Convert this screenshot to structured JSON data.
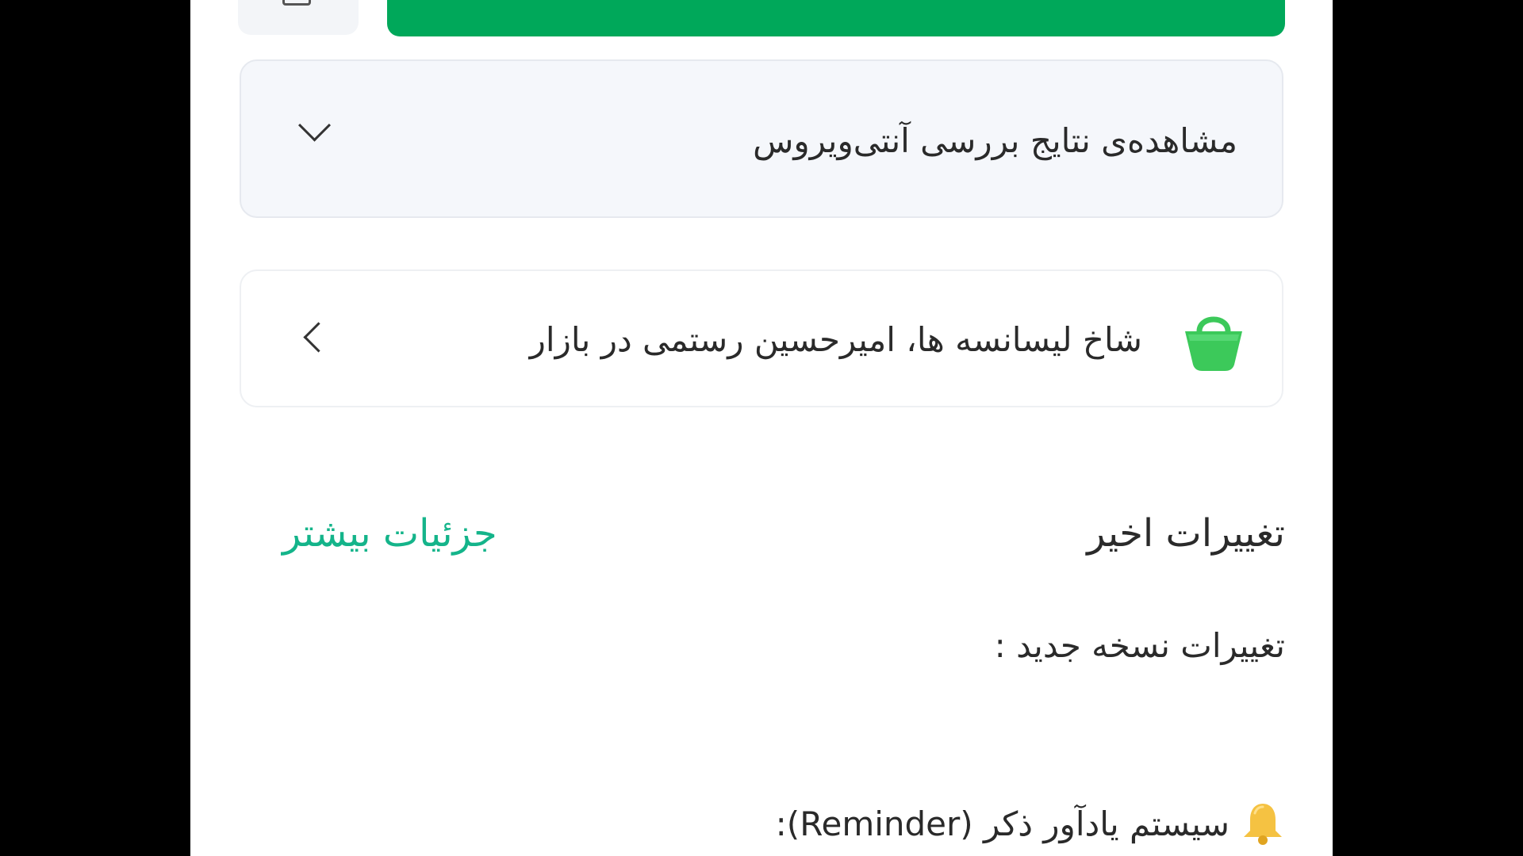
{
  "antivirus": {
    "title": "مشاهده‌ی نتایج بررسی آنتی‌ویروس"
  },
  "developer": {
    "text": "شاخ لیسانسه ها، امیرحسین رستمی در بازار"
  },
  "recent_changes": {
    "title": "تغییرات اخیر",
    "more_link": "جزئیات بیشتر",
    "heading": "تغییرات نسخه جدید :",
    "reminder": "سیستم یادآور ذکر (Reminder):"
  },
  "icons": {
    "antivirus_expand": "chevron-down-icon",
    "developer_bag": "shopping-bag-icon",
    "developer_open": "chevron-left-icon",
    "reminder_bell": "bell-icon"
  },
  "colors": {
    "install_button": "#00a85a",
    "link": "#14b48a",
    "bag": "#3cc95a",
    "bell": "#f5c242"
  }
}
